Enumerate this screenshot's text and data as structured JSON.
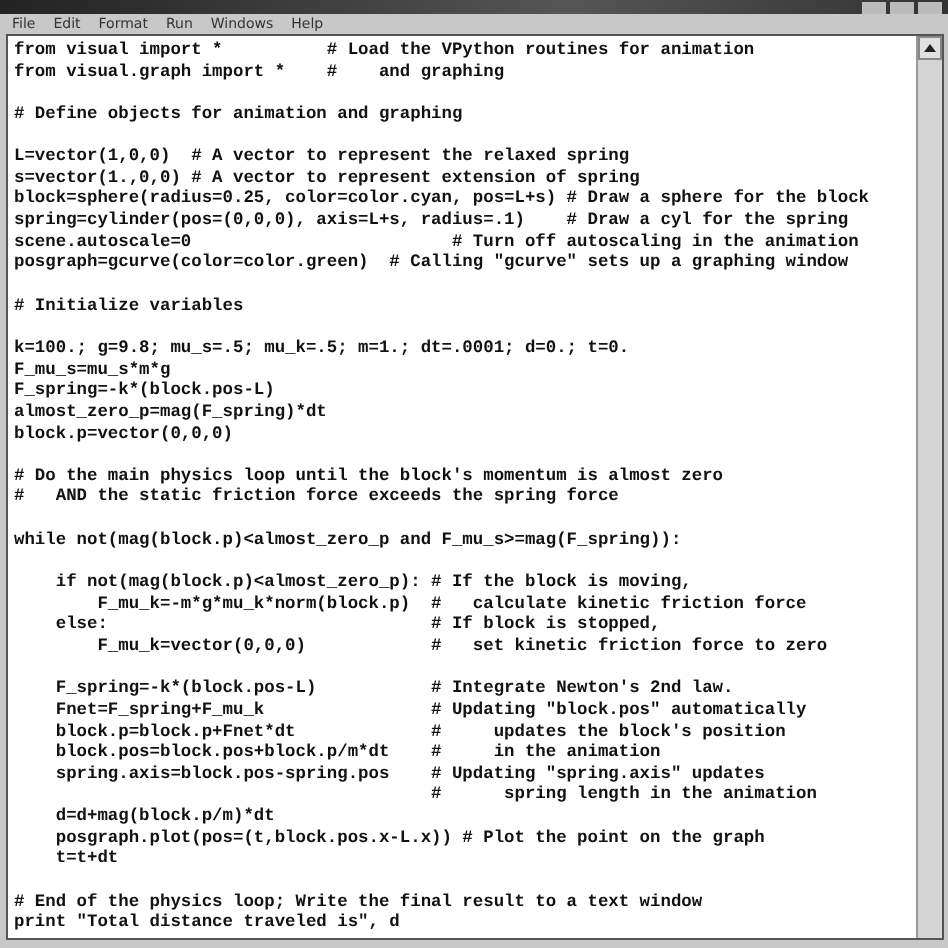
{
  "menu": [
    "File",
    "Edit",
    "Format",
    "Run",
    "Windows",
    "Help"
  ],
  "editor": {
    "blocks": [
      [
        "from visual import *          # Load the VPython routines for animation",
        "from visual.graph import *    #    and graphing"
      ],
      [
        "# Define objects for animation and graphing"
      ],
      [
        "L=vector(1,0,0)  # A vector to represent the relaxed spring",
        "s=vector(1.,0,0) # A vector to represent extension of spring",
        "block=sphere(radius=0.25, color=color.cyan, pos=L+s) # Draw a sphere for the block",
        "spring=cylinder(pos=(0,0,0), axis=L+s, radius=.1)    # Draw a cyl for the spring",
        "scene.autoscale=0                         # Turn off autoscaling in the animation",
        "posgraph=gcurve(color=color.green)  # Calling \"gcurve\" sets up a graphing window"
      ],
      [
        "# Initialize variables"
      ],
      [
        "k=100.; g=9.8; mu_s=.5; mu_k=.5; m=1.; dt=.0001; d=0.; t=0.",
        "F_mu_s=mu_s*m*g",
        "F_spring=-k*(block.pos-L)",
        "almost_zero_p=mag(F_spring)*dt",
        "block.p=vector(0,0,0)"
      ],
      [
        "# Do the main physics loop until the block's momentum is almost zero",
        "#   AND the static friction force exceeds the spring force"
      ],
      [
        "while not(mag(block.p)<almost_zero_p and F_mu_s>=mag(F_spring)):"
      ],
      [
        "    if not(mag(block.p)<almost_zero_p): # If the block is moving,",
        "        F_mu_k=-m*g*mu_k*norm(block.p)  #   calculate kinetic friction force",
        "    else:                               # If block is stopped,",
        "        F_mu_k=vector(0,0,0)            #   set kinetic friction force to zero"
      ],
      [
        "    F_spring=-k*(block.pos-L)           # Integrate Newton's 2nd law.",
        "    Fnet=F_spring+F_mu_k                # Updating \"block.pos\" automatically",
        "    block.p=block.p+Fnet*dt             #     updates the block's position",
        "    block.pos=block.pos+block.p/m*dt    #     in the animation",
        "    spring.axis=block.pos-spring.pos    # Updating \"spring.axis\" updates",
        "                                        #      spring length in the animation",
        "    d=d+mag(block.p/m)*dt",
        "    posgraph.plot(pos=(t,block.pos.x-L.x)) # Plot the point on the graph",
        "    t=t+dt"
      ],
      [
        "# End of the physics loop; Write the final result to a text window",
        "print \"Total distance traveled is\", d"
      ]
    ]
  }
}
